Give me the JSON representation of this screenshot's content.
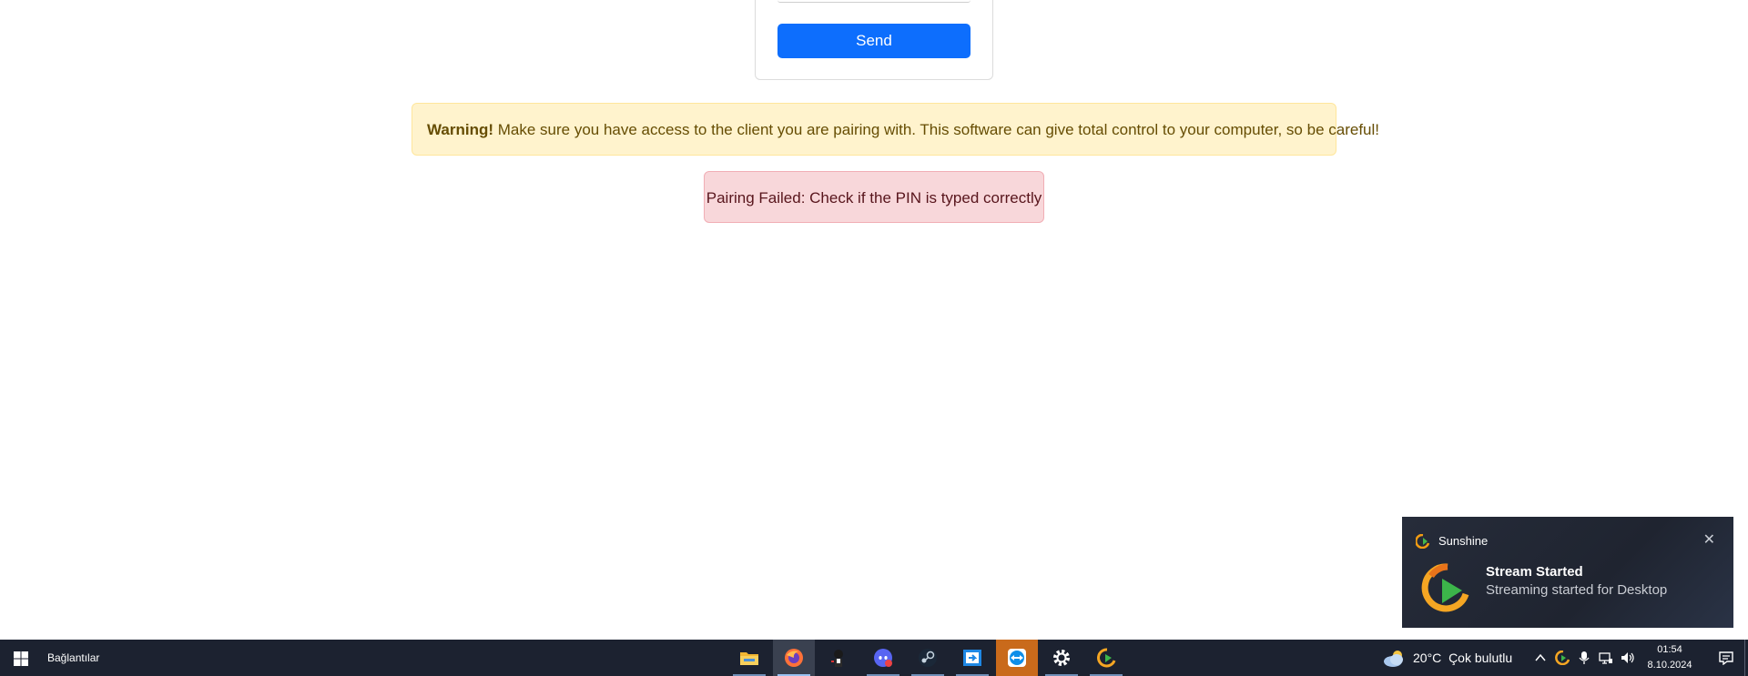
{
  "pairing": {
    "send_label": "Send"
  },
  "alerts": {
    "warning_strong": "Warning!",
    "warning_text": " Make sure you have access to the client you are pairing with. This software can give total control to your computer, so be careful!",
    "error_text": "Pairing Failed: Check if the PIN is typed correctly"
  },
  "toast": {
    "app_name": "Sunshine",
    "title": "Stream Started",
    "body": "Streaming started for Desktop",
    "close_glyph": "✕"
  },
  "taskbar": {
    "toolbar_label": "Bağlantılar",
    "apps": [
      {
        "name": "file-explorer",
        "icon": "folder-icon"
      },
      {
        "name": "firefox",
        "icon": "firefox-icon",
        "active": true
      },
      {
        "name": "anime-app",
        "icon": "character-icon"
      },
      {
        "name": "discord",
        "icon": "discord-icon"
      },
      {
        "name": "steam",
        "icon": "steam-icon"
      },
      {
        "name": "remote-app",
        "icon": "remote-arrow-icon"
      },
      {
        "name": "teamviewer",
        "icon": "teamviewer-icon",
        "highlight": true
      },
      {
        "name": "settings",
        "icon": "gear-icon"
      },
      {
        "name": "sunshine",
        "icon": "sunshine-icon"
      }
    ],
    "weather": {
      "temp": "20°C",
      "condition": "Çok bulutlu"
    },
    "clock": {
      "time": "01:54",
      "date": "8.10.2024"
    }
  },
  "colors": {
    "send_button": "#0d6efd",
    "warning_bg": "#fff3cd",
    "error_bg": "#f8d7da",
    "taskbar_bg": "#1c2230",
    "teamviewer_highlight": "#c96a1b"
  }
}
